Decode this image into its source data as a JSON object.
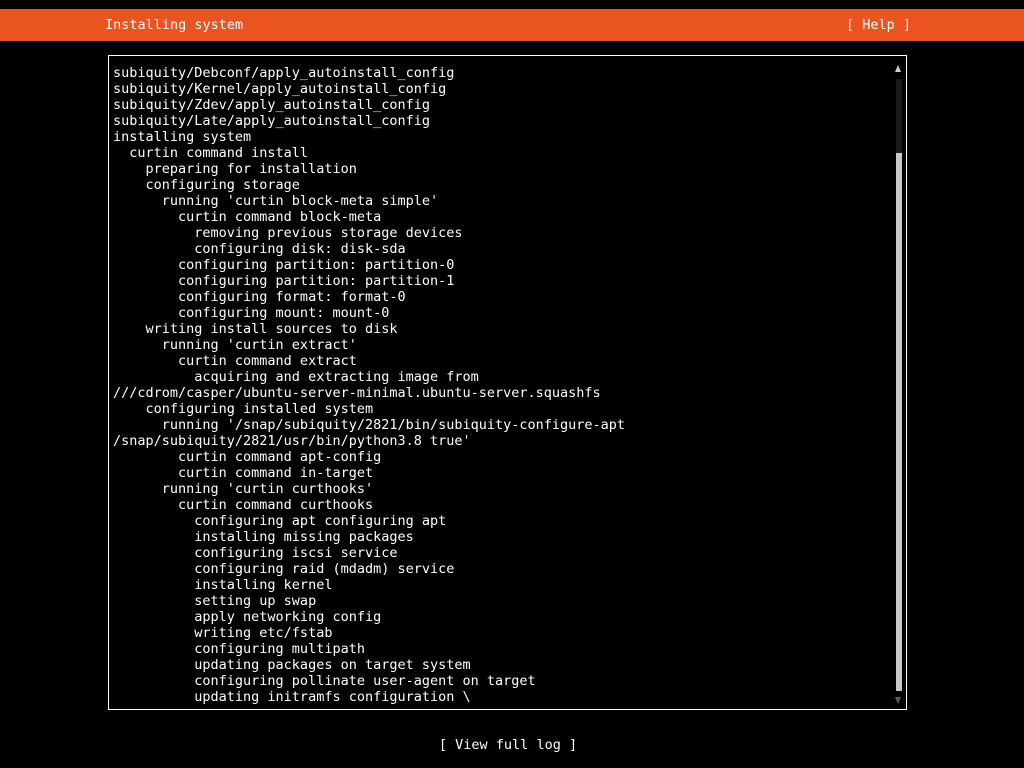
{
  "header": {
    "title": "Installing system",
    "help_label": "[ Help ]"
  },
  "log": {
    "lines": [
      "subiquity/Debconf/apply_autoinstall_config",
      "subiquity/Kernel/apply_autoinstall_config",
      "subiquity/Zdev/apply_autoinstall_config",
      "subiquity/Late/apply_autoinstall_config",
      "installing system",
      "  curtin command install",
      "    preparing for installation",
      "    configuring storage",
      "      running 'curtin block-meta simple'",
      "        curtin command block-meta",
      "          removing previous storage devices",
      "          configuring disk: disk-sda",
      "        configuring partition: partition-0",
      "        configuring partition: partition-1",
      "        configuring format: format-0",
      "        configuring mount: mount-0",
      "    writing install sources to disk",
      "      running 'curtin extract'",
      "        curtin command extract",
      "          acquiring and extracting image from",
      "///cdrom/casper/ubuntu-server-minimal.ubuntu-server.squashfs",
      "    configuring installed system",
      "      running '/snap/subiquity/2821/bin/subiquity-configure-apt",
      "/snap/subiquity/2821/usr/bin/python3.8 true'",
      "        curtin command apt-config",
      "        curtin command in-target",
      "      running 'curtin curthooks'",
      "        curtin command curthooks",
      "          configuring apt configuring apt",
      "          installing missing packages",
      "          configuring iscsi service",
      "          configuring raid (mdadm) service",
      "          installing kernel",
      "          setting up swap",
      "          apply networking config",
      "          writing etc/fstab",
      "          configuring multipath",
      "          updating packages on target system",
      "          configuring pollinate user-agent on target",
      "          updating initramfs configuration \\"
    ]
  },
  "footer": {
    "view_log_label": "[ View full log ]"
  },
  "colors": {
    "header_bg": "#e95420",
    "background": "#000000",
    "text": "#ffffff"
  }
}
